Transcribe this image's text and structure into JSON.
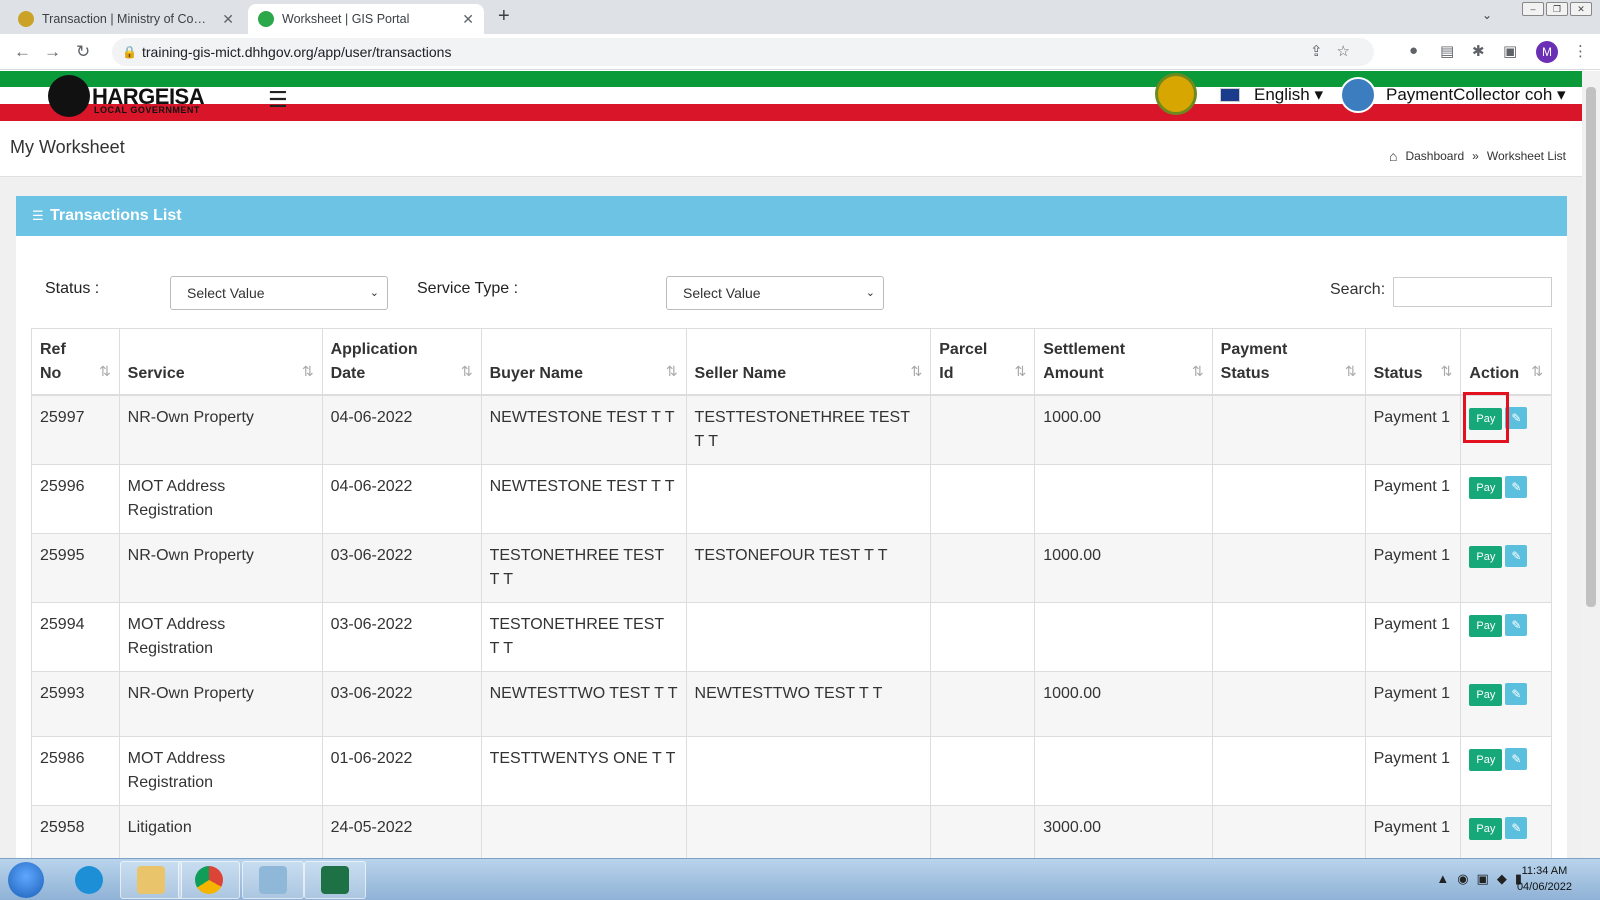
{
  "browser": {
    "tabs": [
      {
        "title": "Transaction | Ministry of Commu",
        "active": false
      },
      {
        "title": "Worksheet | GIS Portal",
        "active": true
      }
    ],
    "url": "training-gis-mict.dhhgov.org/app/user/transactions",
    "profile_initial": "M"
  },
  "header": {
    "logo_title": "HARGEISA",
    "logo_subtitle": "LOCAL GOVERNMENT",
    "language": "English",
    "username": "PaymentCollector coh"
  },
  "page": {
    "title": "My Worksheet",
    "breadcrumb": [
      "Dashboard",
      "»",
      "Worksheet List"
    ]
  },
  "panel": {
    "title": "Transactions List",
    "filters": {
      "status_label": "Status :",
      "status_value": "Select Value",
      "service_type_label": "Service Type :",
      "service_type_value": "Select Value",
      "search_label": "Search:"
    }
  },
  "table": {
    "columns": [
      {
        "label": "Ref\nNo"
      },
      {
        "label": "Service"
      },
      {
        "label": "Application\nDate"
      },
      {
        "label": "Buyer Name"
      },
      {
        "label": "Seller Name"
      },
      {
        "label": "Parcel\nId"
      },
      {
        "label": "Settlement\nAmount"
      },
      {
        "label": "Payment\nStatus"
      },
      {
        "label": "Status"
      },
      {
        "label": "Action"
      }
    ],
    "rows": [
      {
        "ref": "25997",
        "service": "NR-Own Property",
        "date": "04-06-2022",
        "buyer": "NEWTESTONE TEST T T",
        "seller": "TESTTESTONETHREE TEST T T",
        "parcel": "",
        "amount": "1000.00",
        "payment_status": "",
        "status": "Payment 1",
        "pay_label": "Pay"
      },
      {
        "ref": "25996",
        "service": "MOT Address Registration",
        "date": "04-06-2022",
        "buyer": "NEWTESTONE TEST T T",
        "seller": "",
        "parcel": "",
        "amount": "",
        "payment_status": "",
        "status": "Payment 1",
        "pay_label": "Pay"
      },
      {
        "ref": "25995",
        "service": "NR-Own Property",
        "date": "03-06-2022",
        "buyer": "TESTONETHREE TEST T T",
        "seller": "TESTONEFOUR TEST T T",
        "parcel": "",
        "amount": "1000.00",
        "payment_status": "",
        "status": "Payment 1",
        "pay_label": "Pay"
      },
      {
        "ref": "25994",
        "service": "MOT Address Registration",
        "date": "03-06-2022",
        "buyer": "TESTONETHREE TEST T T",
        "seller": "",
        "parcel": "",
        "amount": "",
        "payment_status": "",
        "status": "Payment 1",
        "pay_label": "Pay"
      },
      {
        "ref": "25993",
        "service": "NR-Own Property",
        "date": "03-06-2022",
        "buyer": "NEWTESTTWO TEST T T",
        "seller": "NEWTESTTWO TEST T T",
        "parcel": "",
        "amount": "1000.00",
        "payment_status": "",
        "status": "Payment 1",
        "pay_label": "Pay"
      },
      {
        "ref": "25986",
        "service": "MOT Address Registration",
        "date": "01-06-2022",
        "buyer": "TESTTWENTYS ONE T T",
        "seller": "",
        "parcel": "",
        "amount": "",
        "payment_status": "",
        "status": "Payment 1",
        "pay_label": "Pay"
      },
      {
        "ref": "25958",
        "service": "Litigation",
        "date": "24-05-2022",
        "buyer": "",
        "seller": "",
        "parcel": "",
        "amount": "3000.00",
        "payment_status": "",
        "status": "Payment 1",
        "pay_label": "Pay"
      }
    ]
  },
  "taskbar": {
    "time": "11:34 AM",
    "date": "04/06/2022"
  },
  "colors": {
    "panel_header": "#6cc3e3",
    "pay_button": "#16a878",
    "edit_button": "#5bc0de",
    "highlight": "#e3101f"
  }
}
